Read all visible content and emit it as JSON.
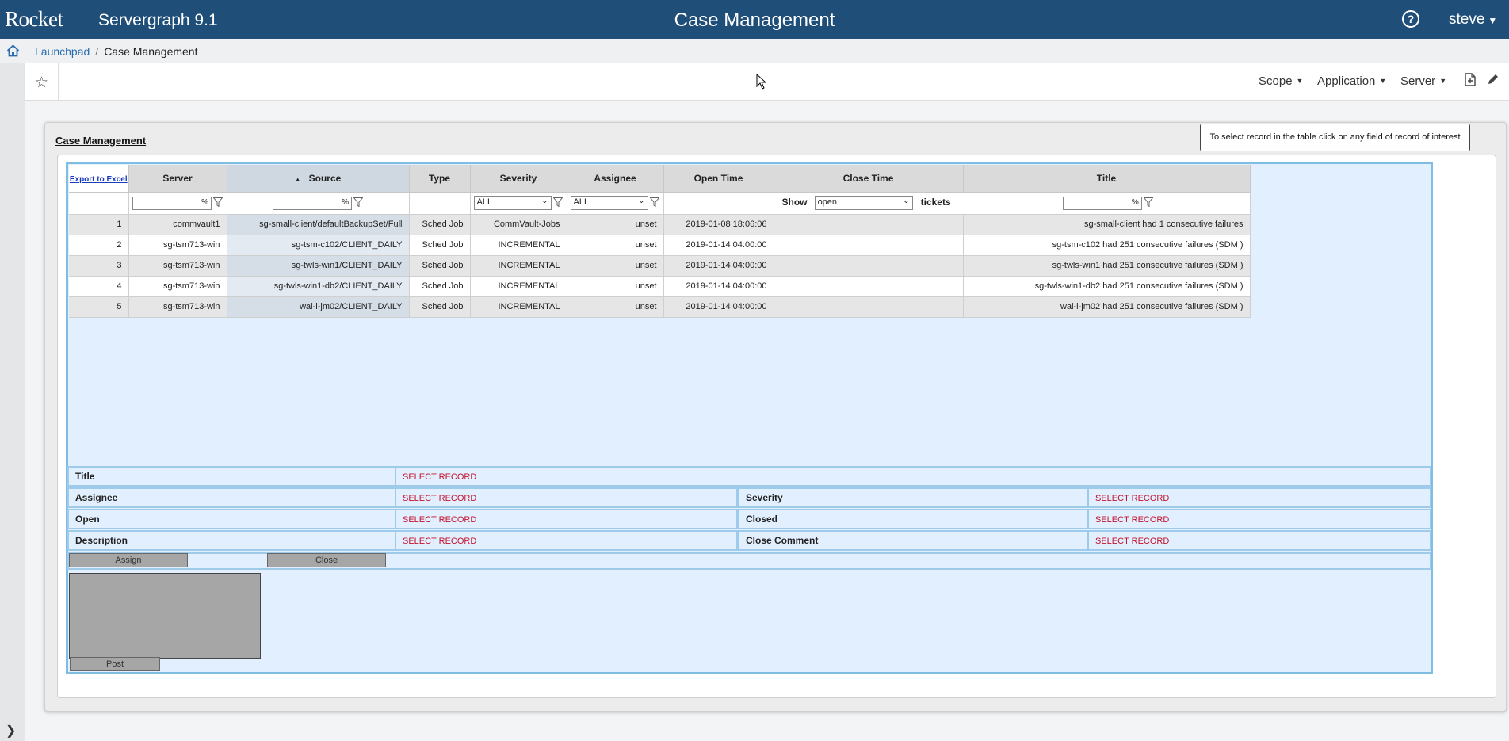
{
  "topbar": {
    "logo": "Rocket",
    "product": "Servergraph 9.1",
    "title": "Case Management",
    "user": "steve"
  },
  "breadcrumb": {
    "items": [
      "Launchpad",
      "Case Management"
    ]
  },
  "toolbar": {
    "menus": [
      "Scope",
      "Application",
      "Server"
    ]
  },
  "section": {
    "title": "Case Management",
    "hint": "To select record in the table click on any field of record of interest"
  },
  "table": {
    "export_label": "Export to Excel",
    "columns": [
      "Server",
      "Source",
      "Type",
      "Severity",
      "Assignee",
      "Open Time",
      "Close Time",
      "Title"
    ],
    "filters": {
      "server": "%",
      "source": "%",
      "severity": "ALL",
      "assignee": "ALL",
      "show_label": "Show",
      "close_status": "open",
      "tickets_label": "tickets",
      "title": "%"
    },
    "rows": [
      {
        "num": "1",
        "server": "commvault1",
        "source": "sg-small-client/defaultBackupSet/Full",
        "type": "Sched Job",
        "severity": "CommVault-Jobs",
        "assignee": "unset",
        "open": "2019-01-08 18:06:06",
        "close": "",
        "title": "sg-small-client had 1 consecutive failures"
      },
      {
        "num": "2",
        "server": "sg-tsm713-win",
        "source": "sg-tsm-c102/CLIENT_DAILY",
        "type": "Sched Job",
        "severity": "INCREMENTAL",
        "assignee": "unset",
        "open": "2019-01-14 04:00:00",
        "close": "",
        "title": "sg-tsm-c102 had 251 consecutive failures (SDM )"
      },
      {
        "num": "3",
        "server": "sg-tsm713-win",
        "source": "sg-twls-win1/CLIENT_DAILY",
        "type": "Sched Job",
        "severity": "INCREMENTAL",
        "assignee": "unset",
        "open": "2019-01-14 04:00:00",
        "close": "",
        "title": "sg-twls-win1 had 251 consecutive failures (SDM )"
      },
      {
        "num": "4",
        "server": "sg-tsm713-win",
        "source": "sg-twls-win1-db2/CLIENT_DAILY",
        "type": "Sched Job",
        "severity": "INCREMENTAL",
        "assignee": "unset",
        "open": "2019-01-14 04:00:00",
        "close": "",
        "title": "sg-twls-win1-db2 had 251 consecutive failures (SDM )"
      },
      {
        "num": "5",
        "server": "sg-tsm713-win",
        "source": "wal-l-jm02/CLIENT_DAILY",
        "type": "Sched Job",
        "severity": "INCREMENTAL",
        "assignee": "unset",
        "open": "2019-01-14 04:00:00",
        "close": "",
        "title": "wal-l-jm02 had 251 consecutive failures (SDM )"
      }
    ]
  },
  "detail": {
    "placeholder": "SELECT RECORD",
    "title_label": "Title",
    "assignee_label": "Assignee",
    "severity_label": "Severity",
    "open_label": "Open",
    "closed_label": "Closed",
    "description_label": "Description",
    "close_comment_label": "Close Comment",
    "assign_button": "Assign",
    "close_button": "Close",
    "post_button": "Post"
  }
}
